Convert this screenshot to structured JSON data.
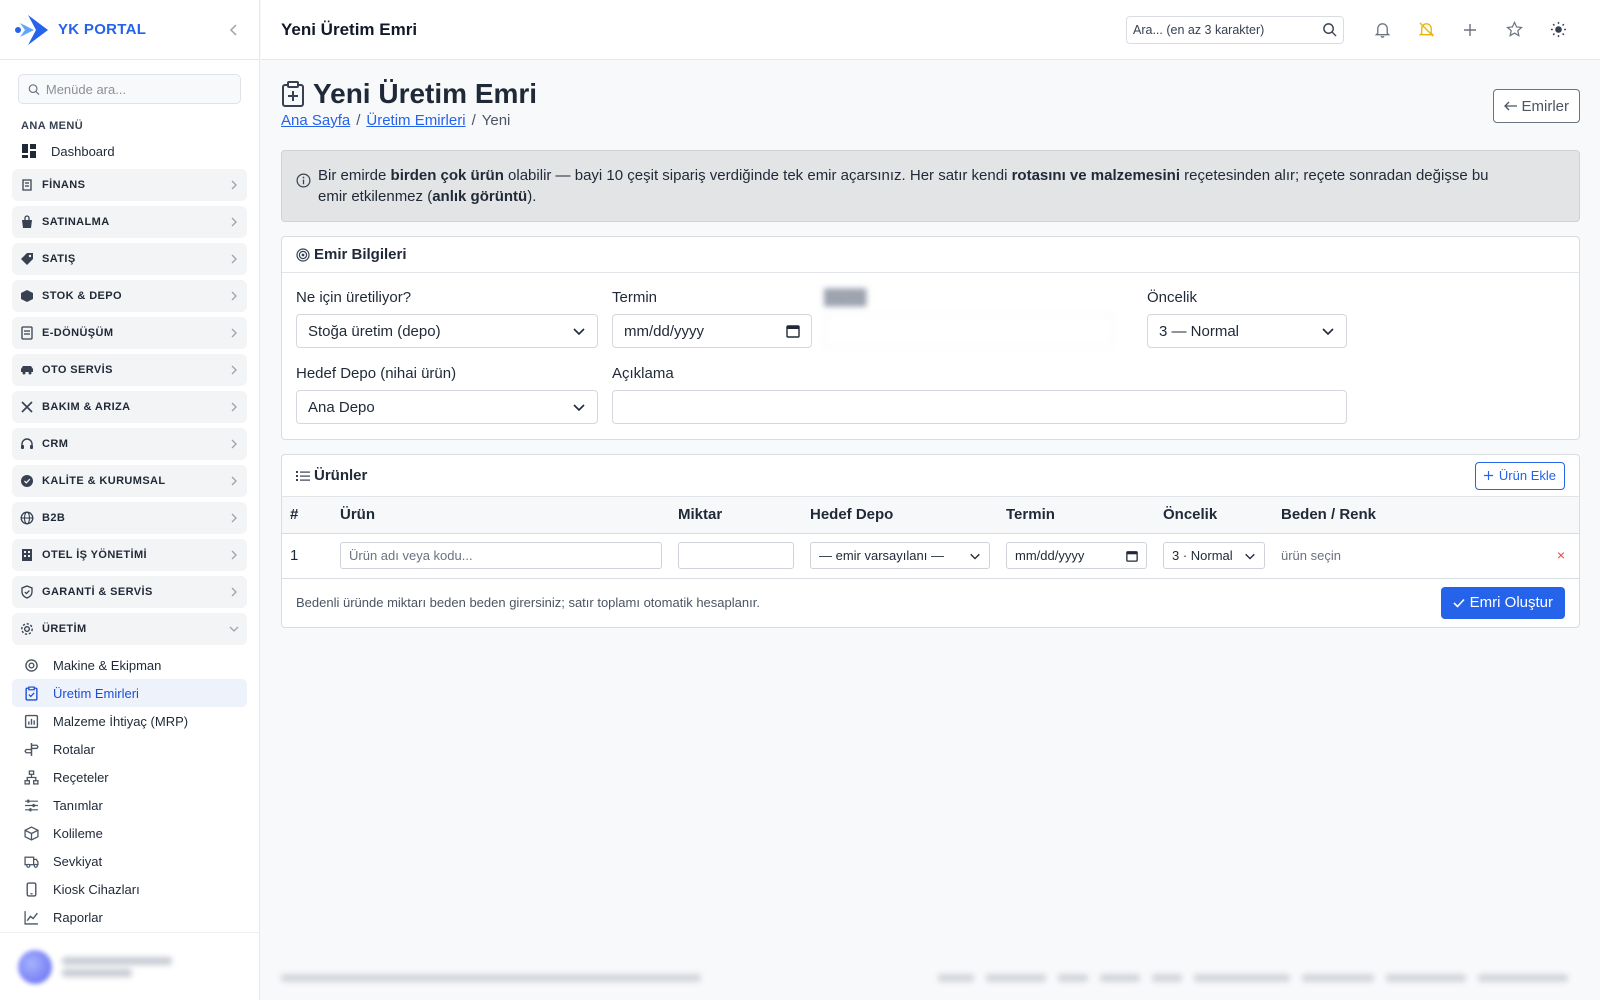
{
  "brand": {
    "name": "YK PORTAL"
  },
  "sidebar": {
    "search_placeholder": "Menüde ara...",
    "section_title": "ANA MENÜ",
    "dashboard_label": "Dashboard",
    "groups": [
      {
        "label": "FİNANS",
        "icon": "finance-icon"
      },
      {
        "label": "SATINALMA",
        "icon": "purchase-icon"
      },
      {
        "label": "SATIŞ",
        "icon": "tag-icon"
      },
      {
        "label": "STOK & DEPO",
        "icon": "box-icon"
      },
      {
        "label": "E-DÖNÜŞÜM",
        "icon": "document-icon"
      },
      {
        "label": "OTO SERVİS",
        "icon": "car-icon"
      },
      {
        "label": "BAKIM & ARIZA",
        "icon": "tools-icon"
      },
      {
        "label": "CRM",
        "icon": "headset-icon"
      },
      {
        "label": "KALİTE & KURUMSAL",
        "icon": "badge-icon"
      },
      {
        "label": "B2B",
        "icon": "globe-icon"
      },
      {
        "label": "OTEL İŞ YÖNETİMİ",
        "icon": "building-icon"
      },
      {
        "label": "GARANTİ & SERVİS",
        "icon": "shield-icon"
      },
      {
        "label": "ÜRETİM",
        "icon": "gear-icon"
      }
    ],
    "sub_items": [
      {
        "label": "Makine & Ekipman",
        "icon": "cog-icon"
      },
      {
        "label": "Üretim Emirleri",
        "icon": "clipboard-icon",
        "active": true
      },
      {
        "label": "Malzeme İhtiyaç (MRP)",
        "icon": "chart-icon"
      },
      {
        "label": "Rotalar",
        "icon": "signpost-icon"
      },
      {
        "label": "Reçeteler",
        "icon": "hierarchy-icon"
      },
      {
        "label": "Tanımlar",
        "icon": "sliders-icon"
      },
      {
        "label": "Kolileme",
        "icon": "package-icon"
      },
      {
        "label": "Sevkiyat",
        "icon": "truck-icon"
      },
      {
        "label": "Kiosk Cihazları",
        "icon": "tablet-icon"
      },
      {
        "label": "Raporlar",
        "icon": "line-chart-icon"
      }
    ]
  },
  "topbar": {
    "title": "Yeni Üretim Emri",
    "search_placeholder": "Ara... (en az 3 karakter)"
  },
  "page": {
    "title": "Yeni Üretim Emri",
    "breadcrumb": {
      "home": "Ana Sayfa",
      "parent": "Üretim Emirleri",
      "current": "Yeni"
    },
    "back_label": "Emirler"
  },
  "alert": {
    "t1": "Bir emirde ",
    "b1": "birden çok ürün",
    "t2": " olabilir — bayi 10 çeşit sipariş verdiğinde tek emir açarsınız. Her satır kendi ",
    "b2": "rotasını ve malzemesini",
    "t3": " reçetesinden alır; reçete sonradan değişse bu emir etkilenmez (",
    "b3": "anlık görüntü",
    "t4": ")."
  },
  "order_info": {
    "title": "Emir Bilgileri",
    "purpose_label": "Ne için üretiliyor?",
    "purpose_value": "Stoğa üretim (depo)",
    "deadline_label": "Termin",
    "deadline_value": "mm/dd/yyyy",
    "priority_label": "Öncelik",
    "priority_value": "3 — Normal",
    "warehouse_label": "Hedef Depo (nihai ürün)",
    "warehouse_value": "Ana Depo",
    "description_label": "Açıklama",
    "description_value": ""
  },
  "products": {
    "title": "Ürünler",
    "add_label": "Ürün Ekle",
    "columns": [
      "#",
      "Ürün",
      "Miktar",
      "Hedef Depo",
      "Termin",
      "Öncelik",
      "Beden / Renk"
    ],
    "rows": [
      {
        "index": "1",
        "product_placeholder": "Ürün adı veya kodu...",
        "quantity": "",
        "warehouse": "— emir varsayılanı —",
        "deadline": "mm/dd/yyyy",
        "priority": "3 · Normal",
        "size_color": "ürün seçin",
        "remove": "×"
      }
    ],
    "footer_note": "Bedenli üründe miktarı beden beden girersiniz; satır toplamı otomatik hesaplanır.",
    "submit_label": "Emri Oluştur"
  }
}
